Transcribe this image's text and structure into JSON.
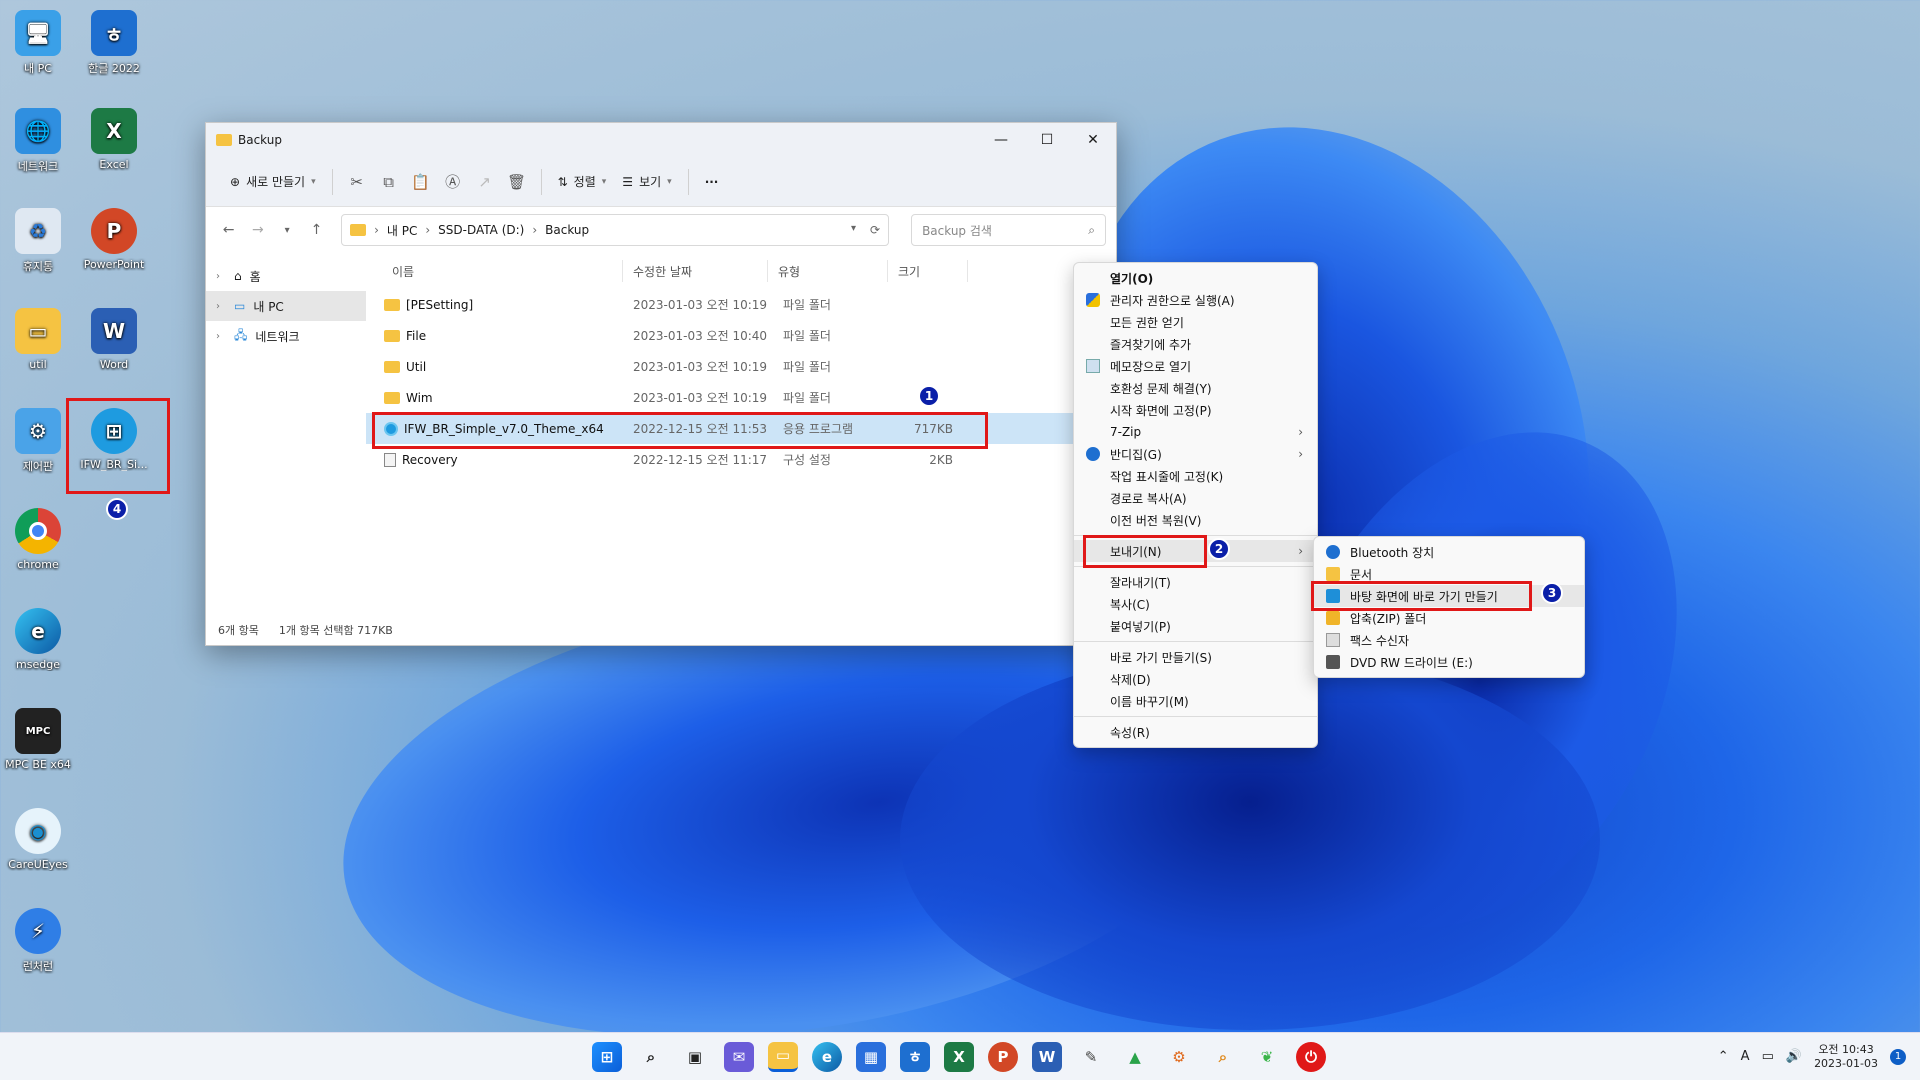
{
  "desktop": {
    "icons": [
      {
        "label": "내 PC"
      },
      {
        "label": "한글 2022"
      },
      {
        "label": "네트워크"
      },
      {
        "label": "Excel"
      },
      {
        "label": "휴지통"
      },
      {
        "label": "PowerPoint"
      },
      {
        "label": "util"
      },
      {
        "label": "Word"
      },
      {
        "label": "제어판"
      },
      {
        "label": "IFW_BR_Si..."
      },
      {
        "label": "chrome"
      },
      {
        "label": "msedge"
      },
      {
        "label": "MPC BE x64"
      },
      {
        "label": "CareUEyes"
      },
      {
        "label": "런처런"
      }
    ]
  },
  "explorer": {
    "title": "Backup",
    "controls": {
      "minimize": "—",
      "maximize": "☐",
      "close": "✕"
    },
    "toolbar": {
      "new_label": "새로 만들기",
      "sort_label": "정렬",
      "view_label": "보기",
      "more_label": "···"
    },
    "address": {
      "crumbs": [
        "내 PC",
        "SSD-DATA (D:)",
        "Backup"
      ],
      "search_placeholder": "Backup 검색"
    },
    "nav": [
      {
        "label": "홈"
      },
      {
        "label": "내 PC"
      },
      {
        "label": "네트워크"
      }
    ],
    "columns": {
      "name": "이름",
      "date": "수정한 날짜",
      "type": "유형",
      "size": "크기"
    },
    "files": [
      {
        "name": "[PESetting]",
        "date": "2023-01-03 오전 10:19",
        "type": "파일 폴더",
        "size": ""
      },
      {
        "name": "File",
        "date": "2023-01-03 오전 10:40",
        "type": "파일 폴더",
        "size": ""
      },
      {
        "name": "Util",
        "date": "2023-01-03 오전 10:19",
        "type": "파일 폴더",
        "size": ""
      },
      {
        "name": "Wim",
        "date": "2023-01-03 오전 10:19",
        "type": "파일 폴더",
        "size": ""
      },
      {
        "name": "IFW_BR_Simple_v7.0_Theme_x64",
        "date": "2022-12-15 오전 11:53",
        "type": "응용 프로그램",
        "size": "717KB"
      },
      {
        "name": "Recovery",
        "date": "2022-12-15 오전 11:17",
        "type": "구성 설정",
        "size": "2KB"
      }
    ],
    "status": {
      "count": "6개 항목",
      "selection": "1개 항목 선택함 717KB"
    }
  },
  "context_menu": {
    "items": [
      {
        "label": "열기(O)"
      },
      {
        "label": "관리자 권한으로 실행(A)"
      },
      {
        "label": "모든 권한 얻기"
      },
      {
        "label": "즐겨찾기에 추가"
      },
      {
        "label": "메모장으로 열기"
      },
      {
        "label": "호환성 문제 해결(Y)"
      },
      {
        "label": "시작 화면에 고정(P)"
      },
      {
        "label": "7-Zip"
      },
      {
        "label": "반디집(G)"
      },
      {
        "label": "작업 표시줄에 고정(K)"
      },
      {
        "label": "경로로 복사(A)"
      },
      {
        "label": "이전 버전 복원(V)"
      },
      {
        "label": "보내기(N)"
      },
      {
        "label": "잘라내기(T)"
      },
      {
        "label": "복사(C)"
      },
      {
        "label": "붙여넣기(P)"
      },
      {
        "label": "바로 가기 만들기(S)"
      },
      {
        "label": "삭제(D)"
      },
      {
        "label": "이름 바꾸기(M)"
      },
      {
        "label": "속성(R)"
      }
    ]
  },
  "sendto_menu": {
    "items": [
      {
        "label": "Bluetooth 장치"
      },
      {
        "label": "문서"
      },
      {
        "label": "바탕 화면에 바로 가기 만들기"
      },
      {
        "label": "압축(ZIP) 폴더"
      },
      {
        "label": "팩스 수신자"
      },
      {
        "label": "DVD RW 드라이브 (E:)"
      }
    ]
  },
  "badges": [
    "1",
    "2",
    "3",
    "4"
  ],
  "taskbar": {
    "clock_time": "오전 10:43",
    "clock_date": "2023-01-03",
    "notifications": "1",
    "ime": "A"
  },
  "colors": {
    "accent": "#0a1fa8",
    "highlight": "#e01818",
    "selection": "#cce4f7"
  }
}
